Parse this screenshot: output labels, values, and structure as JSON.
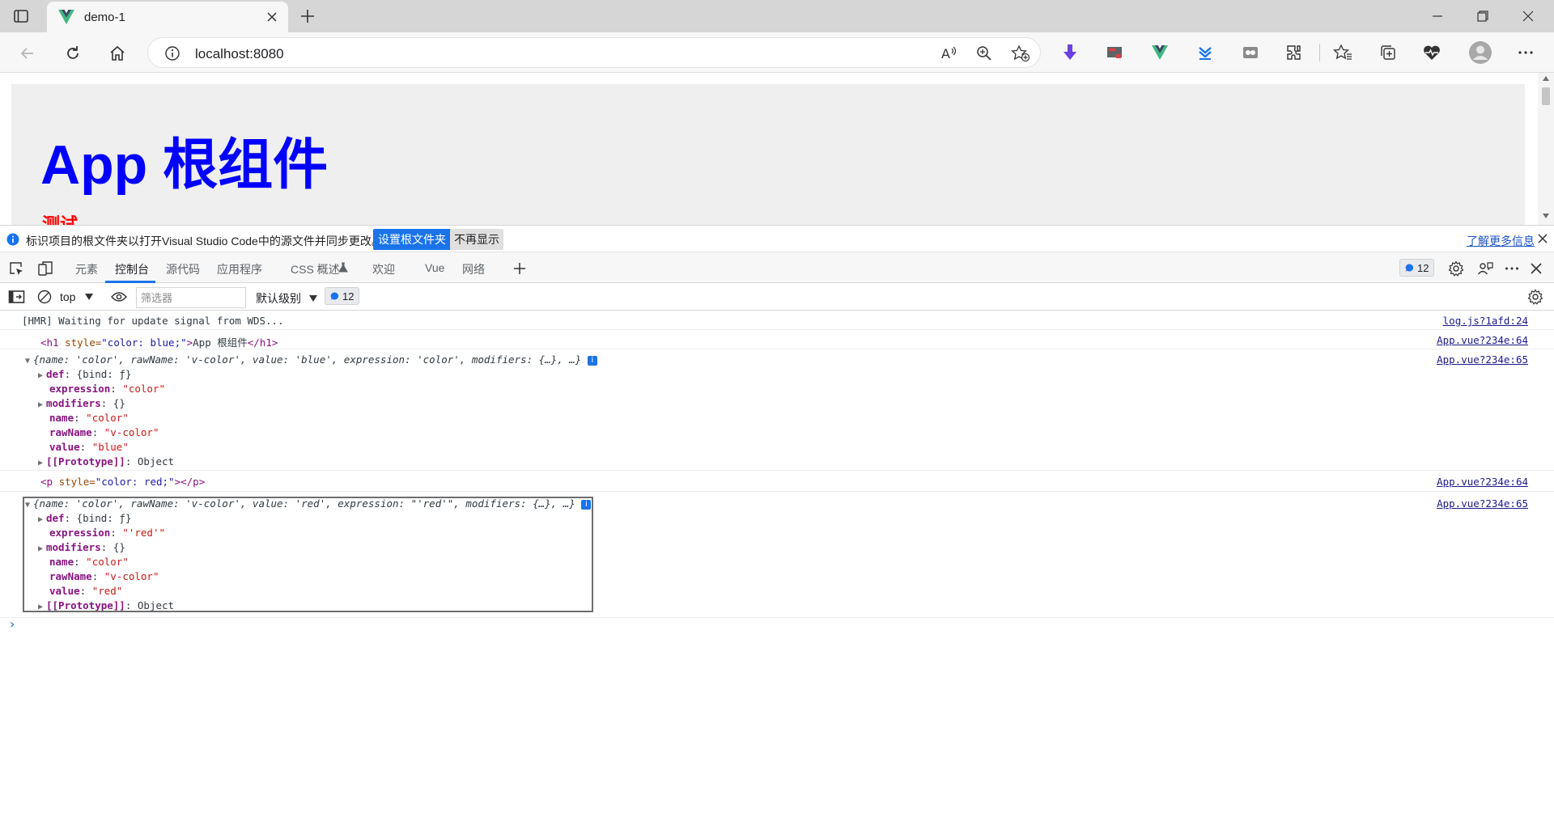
{
  "browser": {
    "tab_title": "demo-1",
    "url": "localhost:8080"
  },
  "page": {
    "heading": "App 根组件",
    "paragraph": "测试"
  },
  "infobar": {
    "message": "标识项目的根文件夹以打开Visual Studio Code中的源文件并同步更改。",
    "primary_button": "设置根文件夹",
    "secondary_button": "不再显示",
    "link": "了解更多信息"
  },
  "devtools": {
    "tabs": [
      "元素",
      "控制台",
      "源代码",
      "应用程序",
      "CSS 概述",
      "欢迎",
      "Vue",
      "网络"
    ],
    "issues_count": "12",
    "toolbar": {
      "context": "top",
      "filter_placeholder": "筛选器",
      "level": "默认级别",
      "issues_count": "12"
    }
  },
  "console": {
    "hmr": "[HMR] Waiting for update signal from WDS...",
    "hmr_src": "log.js?1afd:24",
    "h1_src": "App.vue?234e:64",
    "obj1_src": "App.vue?234e:65",
    "p_src": "App.vue?234e:64",
    "obj2_src": "App.vue?234e:65",
    "h1": {
      "open": "<h1",
      "attr": " style=",
      "val": "\"color: blue;\"",
      "close_open": ">",
      "text": "App 根组件",
      "close_tag": "</h1>"
    },
    "p": {
      "open": "<p",
      "attr": " style=",
      "val": "\"color: red;\"",
      "close_tag": "></p>"
    },
    "obj1": {
      "summary": "{name: 'color', rawName: 'v-color', value: 'blue', expression: 'color', modifiers: {…}, …}",
      "def_key": "def",
      "def_val": "{bind: ƒ}",
      "expr_key": "expression",
      "expr_val": "\"color\"",
      "mod_key": "modifiers",
      "mod_val": "{}",
      "name_key": "name",
      "name_val": "\"color\"",
      "raw_key": "rawName",
      "raw_val": "\"v-color\"",
      "value_key": "value",
      "value_val": "\"blue\"",
      "proto_key": "[[Prototype]]",
      "proto_val": "Object"
    },
    "obj2": {
      "summary": "{name: 'color', rawName: 'v-color', value: 'red', expression: \"'red'\", modifiers: {…}, …}",
      "def_key": "def",
      "def_val": "{bind: ƒ}",
      "expr_key": "expression",
      "expr_val": "\"'red'\"",
      "mod_key": "modifiers",
      "mod_val": "{}",
      "name_key": "name",
      "name_val": "\"color\"",
      "raw_key": "rawName",
      "raw_val": "\"v-color\"",
      "value_key": "value",
      "value_val": "\"red\"",
      "proto_key": "[[Prototype]]",
      "proto_val": "Object"
    },
    "prompt": "›"
  },
  "colors": {
    "vue_green": "#41b883",
    "accent_blue": "#1a73e8",
    "heading_blue": "#0000ff",
    "paragraph_red": "#ff0000"
  }
}
